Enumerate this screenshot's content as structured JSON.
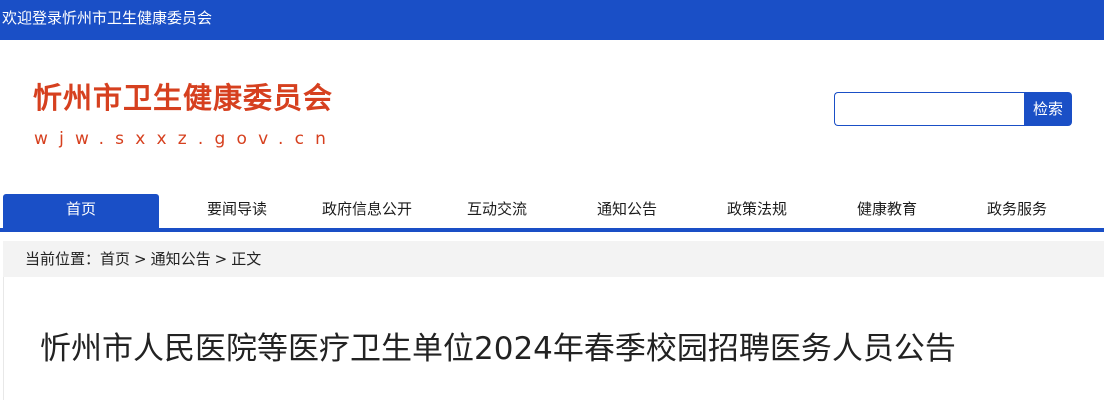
{
  "topbar": {
    "welcome": "欢迎登录忻州市卫生健康委员会"
  },
  "header": {
    "logo_title": "忻州市卫生健康委员会",
    "logo_domain": "wjw.sxxz.gov.cn"
  },
  "search": {
    "value": "",
    "placeholder": "",
    "button_label": "检索"
  },
  "nav": {
    "items": [
      {
        "label": "首页",
        "active": true
      },
      {
        "label": "要闻导读"
      },
      {
        "label": "政府信息公开"
      },
      {
        "label": "互动交流"
      },
      {
        "label": "通知公告"
      },
      {
        "label": "政策法规"
      },
      {
        "label": "健康教育"
      },
      {
        "label": "政务服务"
      }
    ]
  },
  "breadcrumb": {
    "prefix": "当前位置：",
    "items": [
      "首页",
      "通知公告",
      "正文"
    ],
    "separator": ">"
  },
  "article": {
    "title": "忻州市人民医院等医疗卫生单位2024年春季校园招聘医务人员公告"
  },
  "colors": {
    "brand_blue": "#1a4fc6",
    "logo_red": "#d6401f"
  }
}
